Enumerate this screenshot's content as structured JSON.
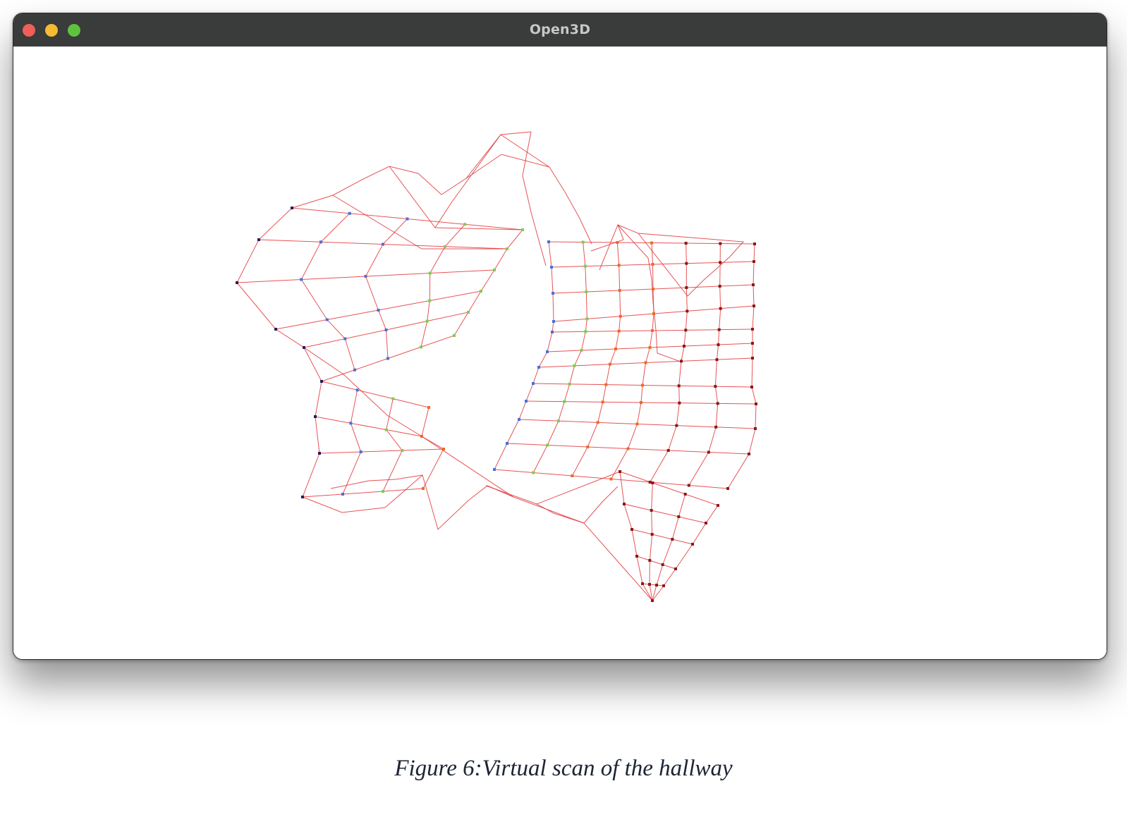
{
  "window": {
    "title": "Open3D",
    "controls": {
      "close_color": "#ee5f57",
      "minimize_color": "#f5bc31",
      "zoom_color": "#5fc23f"
    }
  },
  "scene": {
    "line_color": "#e2353a",
    "point_colors": [
      "#2d1a58",
      "#4a6fd8",
      "#7ccf4a",
      "#f06a1e",
      "#8b1a1a"
    ],
    "background": "#ffffff"
  },
  "caption": "Figure 6:Virtual scan of the hallway"
}
